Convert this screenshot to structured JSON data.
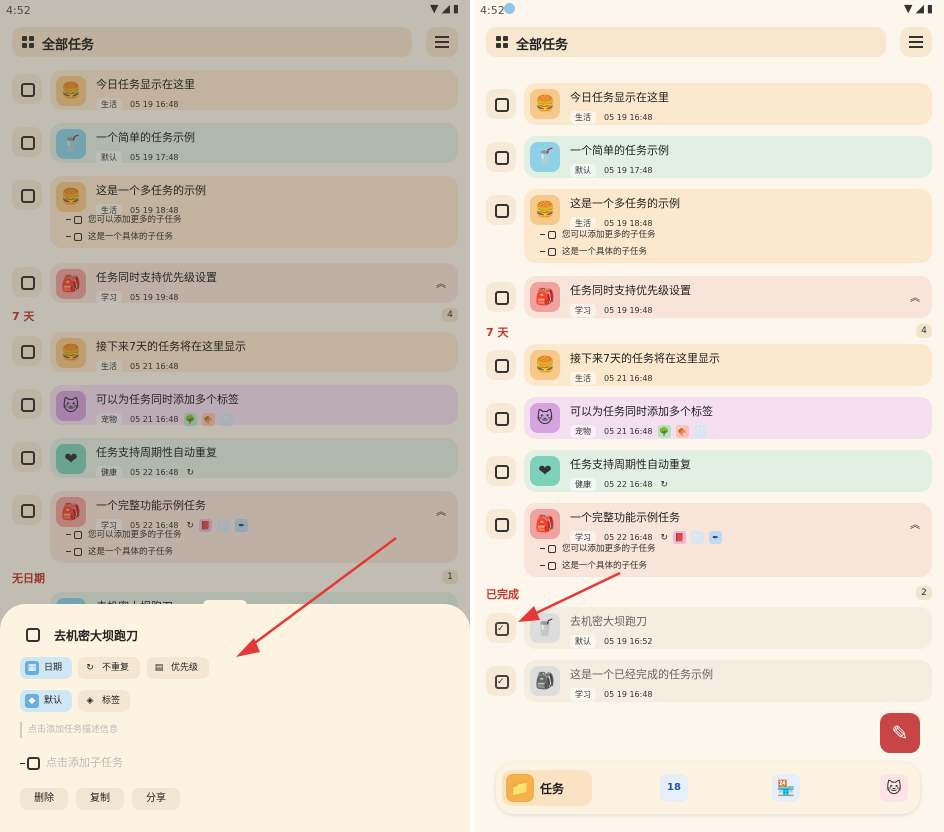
{
  "status": {
    "left_time": "4:52",
    "right_time": "4:52",
    "icons": "▼◢▮"
  },
  "header": {
    "title": "全部任务"
  },
  "colors": {
    "orange_card": "#fbe8cd",
    "blue_card": "#e2f0e4",
    "green_card": "#e2f0e4",
    "purple_card": "#f3dff0",
    "red_card": "#f8e4d8",
    "gray_card": "#f5ede0",
    "fab": "#c94545",
    "arrow": "#e53935"
  },
  "tasks": {
    "t1": {
      "title": "今日任务显示在这里",
      "tag": "生活",
      "date": "05 19 16:48",
      "icon": "burger-icon"
    },
    "t2": {
      "title": "一个简单的任务示例",
      "tag": "默认",
      "date": "05 19 17:48",
      "icon": "cup-icon"
    },
    "t3": {
      "title": "这是一个多任务的示例",
      "tag": "生活",
      "date": "05 19 18:48",
      "icon": "burger-icon",
      "subtasks": [
        "您可以添加更多的子任务",
        "这是一个具体的子任务"
      ]
    },
    "t4": {
      "title": "任务同时支持优先级设置",
      "tag": "学习",
      "date": "05 19 19:48",
      "icon": "backpack-icon"
    },
    "t5": {
      "title": "接下来7天的任务将在这里显示",
      "tag": "生活",
      "date": "05 21 16:48",
      "icon": "burger-icon"
    },
    "t6": {
      "title": "可以为任务同时添加多个标签",
      "tag": "宠物",
      "date": "05 21 16:48",
      "icon": "pet-icon"
    },
    "t7": {
      "title": "任务支持周期性自动重复",
      "tag": "健康",
      "date": "05 22 16:48",
      "icon": "heart-icon"
    },
    "t8": {
      "title": "一个完整功能示例任务",
      "tag": "学习",
      "date": "05 22 16:48",
      "icon": "backpack-icon",
      "subtasks": [
        "您可以添加更多的子任务",
        "这是一个具体的子任务"
      ]
    },
    "t9": {
      "title": "去机密大坝跑刀",
      "tag": "默认",
      "date": "05 19 16:52",
      "icon": "cup-icon"
    },
    "t10": {
      "title": "这是一个已经完成的任务示例",
      "tag": "学习",
      "date": "05 19 16:48",
      "icon": "backpack-icon"
    }
  },
  "sections": {
    "seven_days": {
      "title": "7 天",
      "count": "4"
    },
    "no_date": {
      "title": "无日期",
      "count": "1"
    },
    "done": {
      "title": "已完成",
      "count": "2"
    }
  },
  "left_partial_title": "去机密大坝跑刀",
  "sheet": {
    "title": "去机密大坝跑刀",
    "chip_date": "日期",
    "chip_repeat": "不重复",
    "chip_priority": "优先级",
    "chip_default": "默认",
    "chip_tags": "标签",
    "desc_placeholder": "点击添加任务描述信息",
    "subtask_placeholder": "点击添加子任务",
    "btn_delete": "删除",
    "btn_copy": "复制",
    "btn_share": "分享"
  },
  "nav": {
    "tasks_label": "任务",
    "calendar_day": "18"
  }
}
